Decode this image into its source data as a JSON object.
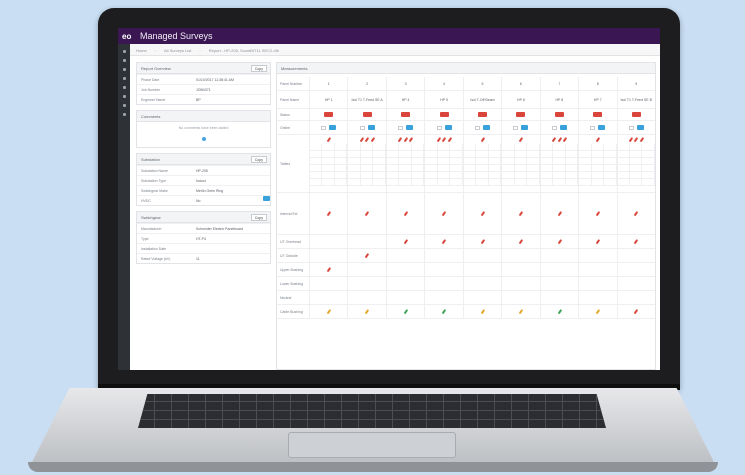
{
  "app": {
    "title": "Managed Surveys",
    "logo": "eo"
  },
  "breadcrumb": [
    "Home",
    "All Surveys List",
    "Report - HP-205, ScoutBIT11 SEC2-4th"
  ],
  "report_overview": {
    "title": "Report Overview",
    "copy_label": "Copy",
    "fields": [
      {
        "k": "Phase Date",
        "v": "01/10/2017 11:38:41 AM"
      },
      {
        "k": "Job Number",
        "v": "JOB4371"
      },
      {
        "k": "Engineer Name",
        "v": "BP"
      }
    ]
  },
  "comments": {
    "title": "Comments",
    "empty": "No comments have been added"
  },
  "substation": {
    "title": "Substation",
    "copy_label": "Copy",
    "fields": [
      {
        "k": "Substation Name",
        "v": "HP-205"
      },
      {
        "k": "Substation Type",
        "v": "Indoor"
      },
      {
        "k": "Switchgear Make",
        "v": "Merlin Gerin Ring"
      },
      {
        "k": "HVDC",
        "v": "No"
      }
    ]
  },
  "switchgear": {
    "title": "Switchgear",
    "copy_label": "Copy",
    "fields": [
      {
        "k": "Manufacturer",
        "v": "Schneider Electric Panelboard"
      },
      {
        "k": "Type",
        "v": "HT-P4"
      },
      {
        "k": "Installation Date",
        "v": ""
      },
      {
        "k": "Rated Voltage (kV)",
        "v": "11"
      }
    ]
  },
  "measurements": {
    "title": "Measurements",
    "panels": [
      "1",
      "2",
      "3",
      "4",
      "5",
      "6",
      "7",
      "8",
      "9"
    ],
    "panel_names": [
      "HP 1",
      "Isol T1 T-Feed SE A",
      "HP 4",
      "HP 5",
      "Isol T-Off Beam",
      "HP 6",
      "HP 8",
      "HP 7",
      "Isol T1 T-Feed SE B"
    ],
    "row_labels": {
      "panel_number": "Panel Number",
      "panel_name": "Panel Name",
      "status": "Status",
      "online": "Online",
      "tables": "Tables",
      "interval": "Interval Ext",
      "ut_overhead": "UT Overhead",
      "ut_outside": "UT Outside",
      "upper_bushing": "Upper Bushing",
      "lower_bushing": "Lower Bushing",
      "neutral": "Neutral",
      "cable_bushing": "Cable Bushing"
    },
    "online_value": "OK"
  },
  "colors": {
    "topbar": "#3a1752",
    "accent": "#37a2dc",
    "danger": "#d9443b",
    "ok": "#3aa355",
    "warn": "#e3a72a"
  }
}
